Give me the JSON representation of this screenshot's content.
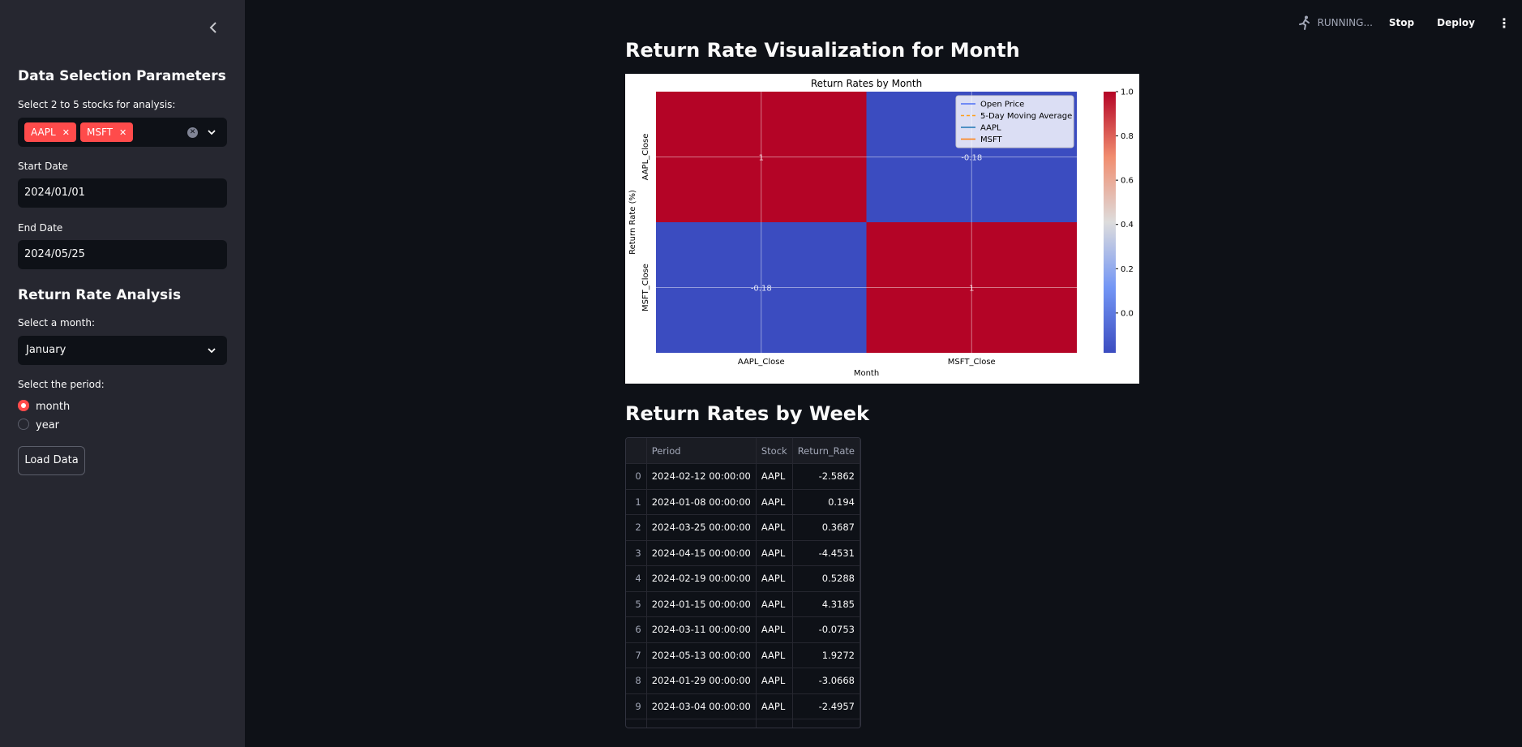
{
  "header": {
    "status": "RUNNING...",
    "stop_label": "Stop",
    "deploy_label": "Deploy"
  },
  "sidebar": {
    "title": "Data Selection Parameters",
    "stocks_label": "Select 2 to 5 stocks for analysis:",
    "stocks": [
      "AAPL",
      "MSFT"
    ],
    "start_label": "Start Date",
    "start_value": "2024/01/01",
    "end_label": "End Date",
    "end_value": "2024/05/25",
    "analysis_title": "Return Rate Analysis",
    "month_label": "Select a month:",
    "month_value": "January",
    "period_label": "Select the period:",
    "period_options": [
      "month",
      "year"
    ],
    "period_selected": "month",
    "load_label": "Load Data"
  },
  "main": {
    "viz_title": "Return Rate Visualization for Month",
    "table_title": "Return Rates by Week",
    "table": {
      "columns": [
        "",
        "Period",
        "Stock",
        "Return_Rate"
      ],
      "rows": [
        [
          "0",
          "2024-02-12 00:00:00",
          "AAPL",
          "-2.5862"
        ],
        [
          "1",
          "2024-01-08 00:00:00",
          "AAPL",
          "0.194"
        ],
        [
          "2",
          "2024-03-25 00:00:00",
          "AAPL",
          "0.3687"
        ],
        [
          "3",
          "2024-04-15 00:00:00",
          "AAPL",
          "-4.4531"
        ],
        [
          "4",
          "2024-02-19 00:00:00",
          "AAPL",
          "0.5288"
        ],
        [
          "5",
          "2024-01-15 00:00:00",
          "AAPL",
          "4.3185"
        ],
        [
          "6",
          "2024-03-11 00:00:00",
          "AAPL",
          "-0.0753"
        ],
        [
          "7",
          "2024-05-13 00:00:00",
          "AAPL",
          "1.9272"
        ],
        [
          "8",
          "2024-01-29 00:00:00",
          "AAPL",
          "-3.0668"
        ],
        [
          "9",
          "2024-03-04 00:00:00",
          "AAPL",
          "-2.4957"
        ]
      ]
    }
  },
  "chart_data": {
    "type": "heatmap",
    "title": "Return Rates by Month",
    "xlabel": "Month",
    "ylabel": "Return Rate (%)",
    "x_categories": [
      "AAPL_Close",
      "MSFT_Close"
    ],
    "y_categories": [
      "AAPL_Close",
      "MSFT_Close"
    ],
    "values": [
      [
        1,
        -0.18
      ],
      [
        -0.18,
        1
      ]
    ],
    "value_labels": [
      [
        "1",
        "-0.18"
      ],
      [
        "-0.18",
        "1"
      ]
    ],
    "colormap": "coolwarm",
    "colorbar_ticks": [
      "1.0",
      "0.8",
      "0.6",
      "0.4",
      "0.2",
      "0.0"
    ],
    "colorbar_range": [
      -0.18,
      1.0
    ],
    "legend": [
      "Open Price",
      "5-Day Moving Average",
      "AAPL",
      "MSFT"
    ],
    "legend_placement": "upper right",
    "grid": true,
    "colors": {
      "high": "#b40426",
      "low": "#3b4cc0"
    }
  }
}
